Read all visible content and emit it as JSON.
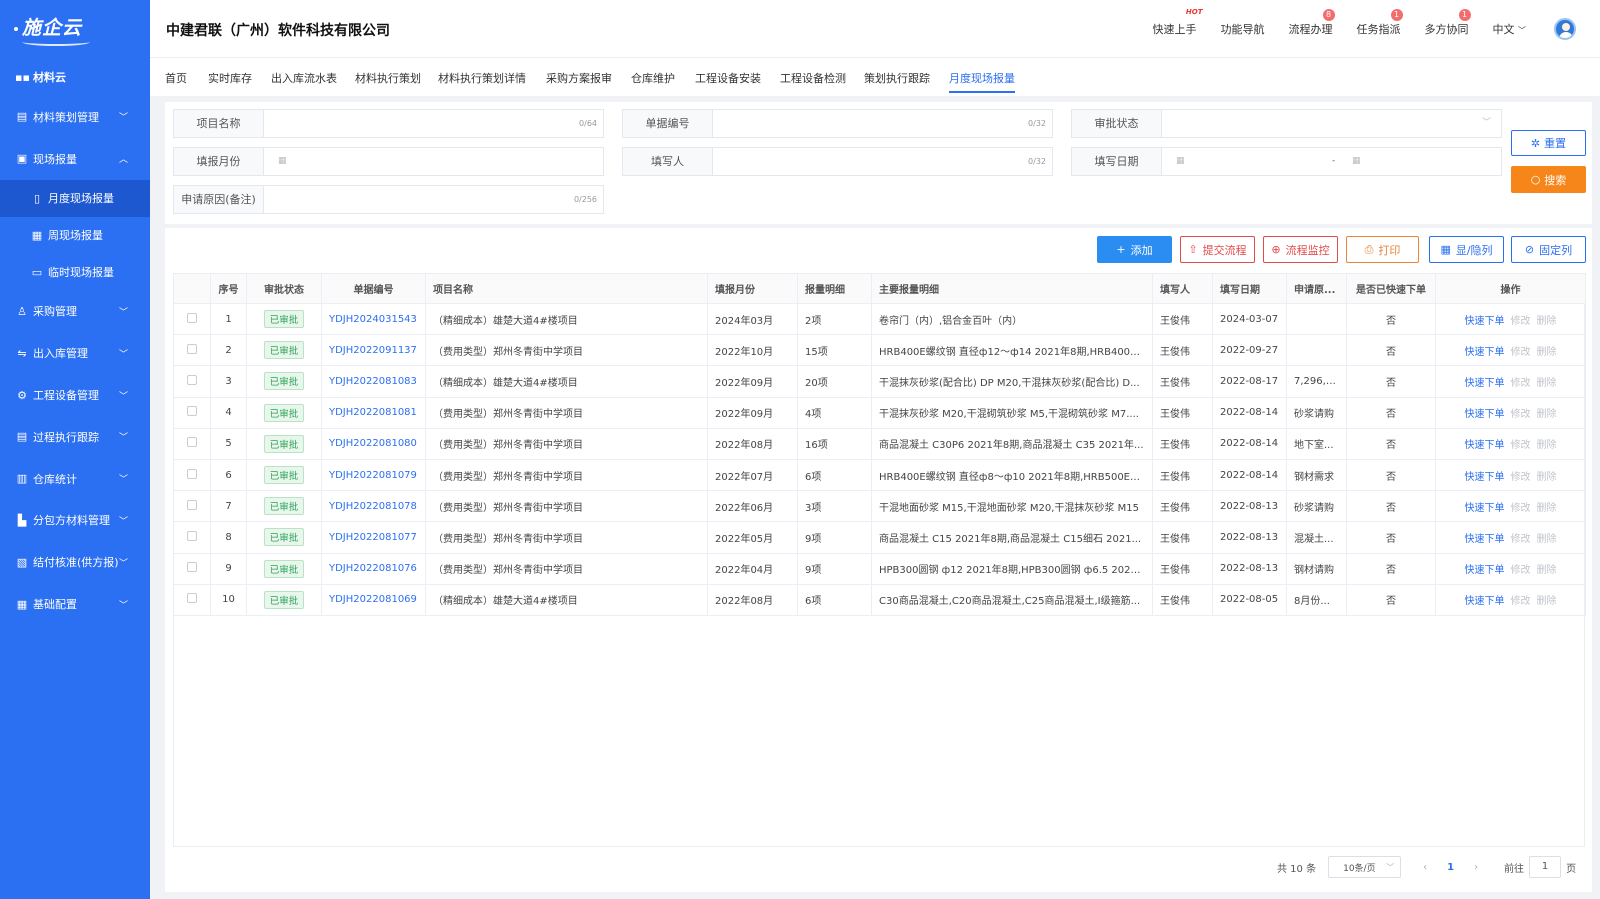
{
  "app": {
    "logo": "施企云",
    "company": "中建君联（广州）软件科技有限公司"
  },
  "header": {
    "links": [
      {
        "label": "快速上手",
        "badge": "HOT"
      },
      {
        "label": "功能导航",
        "badge": ""
      },
      {
        "label": "流程办理",
        "badge": "8"
      },
      {
        "label": "任务指派",
        "badge": "1"
      },
      {
        "label": "多方协同",
        "badge": "1"
      }
    ],
    "lang": "中文"
  },
  "sidebar": {
    "top": "材料云",
    "items": [
      {
        "label": "材料策划管理",
        "icon": "doc-edit-icon",
        "expanded": false
      },
      {
        "label": "现场报量",
        "icon": "report-icon",
        "expanded": true,
        "children": [
          {
            "label": "月度现场报量",
            "icon": "monthly-icon",
            "active": true
          },
          {
            "label": "周现场报量",
            "icon": "calendar-icon",
            "active": false
          },
          {
            "label": "临时现场报量",
            "icon": "temp-report-icon",
            "active": false
          }
        ]
      },
      {
        "label": "采购管理",
        "icon": "people-icon",
        "expanded": false
      },
      {
        "label": "出入库管理",
        "icon": "warehouse-io-icon",
        "expanded": false
      },
      {
        "label": "工程设备管理",
        "icon": "equipment-icon",
        "expanded": false
      },
      {
        "label": "过程执行跟踪",
        "icon": "process-icon",
        "expanded": false
      },
      {
        "label": "仓库统计",
        "icon": "stats-icon",
        "expanded": false
      },
      {
        "label": "分包方材料管理",
        "icon": "chart-icon",
        "expanded": false
      },
      {
        "label": "结付核准(供方报)",
        "icon": "clipboard-check-icon",
        "expanded": false
      },
      {
        "label": "基础配置",
        "icon": "grid-icon",
        "expanded": false
      }
    ]
  },
  "tabs": [
    "首页",
    "实时库存",
    "出入库流水表",
    "材料执行策划",
    "材料执行策划详情",
    "采购方案报审",
    "仓库维护",
    "工程设备安装",
    "工程设备检测",
    "策划执行跟踪",
    "月度现场报量"
  ],
  "active_tab": "月度现场报量",
  "filters": {
    "project_name": {
      "label": "项目名称",
      "count": "0/64"
    },
    "doc_no": {
      "label": "单据编号",
      "count": "0/32"
    },
    "approval": {
      "label": "审批状态"
    },
    "fill_month": {
      "label": "填报月份"
    },
    "filler": {
      "label": "填写人",
      "count": "0/32"
    },
    "fill_date": {
      "label": "填写日期",
      "sep": "-"
    },
    "reason": {
      "label": "申请原因(备注)",
      "count": "0/256"
    },
    "reset": "重置",
    "search": "搜索"
  },
  "toolbar": {
    "add": "添加",
    "submit": "提交流程",
    "monitor": "流程监控",
    "print": "打印",
    "toggle": "显/隐列",
    "fix": "固定列"
  },
  "table": {
    "headers": [
      "序号",
      "审批状态",
      "单据编号",
      "项目名称",
      "填报月份",
      "报量明细",
      "主要报量明细",
      "填写人",
      "填写日期",
      "申请原...",
      "是否已快速下单",
      "操作"
    ],
    "action_labels": {
      "quick": "快速下单",
      "edit": "修改",
      "delete": "删除"
    },
    "rows": [
      {
        "no": "1",
        "status": "已审批",
        "doc": "YDJH2024031543",
        "project": "（精细成本）雄楚大道4#楼项目",
        "month": "2024年03月",
        "detail": "2项",
        "main": "卷帘门（内）,铝合金百叶（内）",
        "filler": "王俊伟",
        "date": "2024-03-07",
        "reason": "",
        "ordered": "否"
      },
      {
        "no": "2",
        "status": "已审批",
        "doc": "YDJH2022091137",
        "project": "（费用类型）郑州冬青街中学项目",
        "month": "2022年10月",
        "detail": "15项",
        "main": "HRB400E螺纹钢 直径ф12～ф14 2021年8期,HRB400E...",
        "filler": "王俊伟",
        "date": "2022-09-27",
        "reason": "",
        "ordered": "否"
      },
      {
        "no": "3",
        "status": "已审批",
        "doc": "YDJH2022081083",
        "project": "（精细成本）雄楚大道4#楼项目",
        "month": "2022年09月",
        "detail": "20项",
        "main": "干混抹灰砂浆(配合比) DP M20,干混抹灰砂浆(配合比) D...",
        "filler": "王俊伟",
        "date": "2022-08-17",
        "reason": "7,296,1...",
        "ordered": "否"
      },
      {
        "no": "4",
        "status": "已审批",
        "doc": "YDJH2022081081",
        "project": "（费用类型）郑州冬青街中学项目",
        "month": "2022年09月",
        "detail": "4项",
        "main": "干混抹灰砂浆 M20,干混砌筑砂浆 M5,干混砌筑砂浆 M7....",
        "filler": "王俊伟",
        "date": "2022-08-14",
        "reason": "砂浆请购",
        "ordered": "否"
      },
      {
        "no": "5",
        "status": "已审批",
        "doc": "YDJH2022081080",
        "project": "（费用类型）郑州冬青街中学项目",
        "month": "2022年08月",
        "detail": "16项",
        "main": "商品混凝土 C30P6 2021年8期,商品混凝土 C35 2021年...",
        "filler": "王俊伟",
        "date": "2022-08-14",
        "reason": "地下室...",
        "ordered": "否"
      },
      {
        "no": "6",
        "status": "已审批",
        "doc": "YDJH2022081079",
        "project": "（费用类型）郑州冬青街中学项目",
        "month": "2022年07月",
        "detail": "6项",
        "main": "HRB400E螺纹钢 直径ф8～ф10 2021年8期,HRB500E螺...",
        "filler": "王俊伟",
        "date": "2022-08-14",
        "reason": "钢材需求",
        "ordered": "否"
      },
      {
        "no": "7",
        "status": "已审批",
        "doc": "YDJH2022081078",
        "project": "（费用类型）郑州冬青街中学项目",
        "month": "2022年06月",
        "detail": "3项",
        "main": "干混地面砂浆 M15,干混地面砂浆 M20,干混抹灰砂浆 M15",
        "filler": "王俊伟",
        "date": "2022-08-13",
        "reason": "砂浆请购",
        "ordered": "否"
      },
      {
        "no": "8",
        "status": "已审批",
        "doc": "YDJH2022081077",
        "project": "（费用类型）郑州冬青街中学项目",
        "month": "2022年05月",
        "detail": "9项",
        "main": "商品混凝土 C15 2021年8期,商品混凝土 C15细石 2021...",
        "filler": "王俊伟",
        "date": "2022-08-13",
        "reason": "混凝土...",
        "ordered": "否"
      },
      {
        "no": "9",
        "status": "已审批",
        "doc": "YDJH2022081076",
        "project": "（费用类型）郑州冬青街中学项目",
        "month": "2022年04月",
        "detail": "9项",
        "main": "HPB300圆钢 ф12 2021年8期,HPB300圆钢 ф6.5 2021...",
        "filler": "王俊伟",
        "date": "2022-08-13",
        "reason": "钢材请购",
        "ordered": "否"
      },
      {
        "no": "10",
        "status": "已审批",
        "doc": "YDJH2022081069",
        "project": "（精细成本）雄楚大道4#楼项目",
        "month": "2022年08月",
        "detail": "6项",
        "main": "C30商品混凝土,C20商品混凝土,C25商品混凝土,I级箍筋...",
        "filler": "王俊伟",
        "date": "2022-08-05",
        "reason": "8月份...",
        "ordered": "否"
      }
    ]
  },
  "pagination": {
    "total": "共 10 条",
    "page_size": "10条/页",
    "current": "1",
    "goto_prefix": "前往",
    "goto_value": "1",
    "goto_suffix": "页"
  },
  "colors": {
    "primary": "#2b6ff2",
    "orange": "#f7861a",
    "danger": "#e34a4a"
  }
}
